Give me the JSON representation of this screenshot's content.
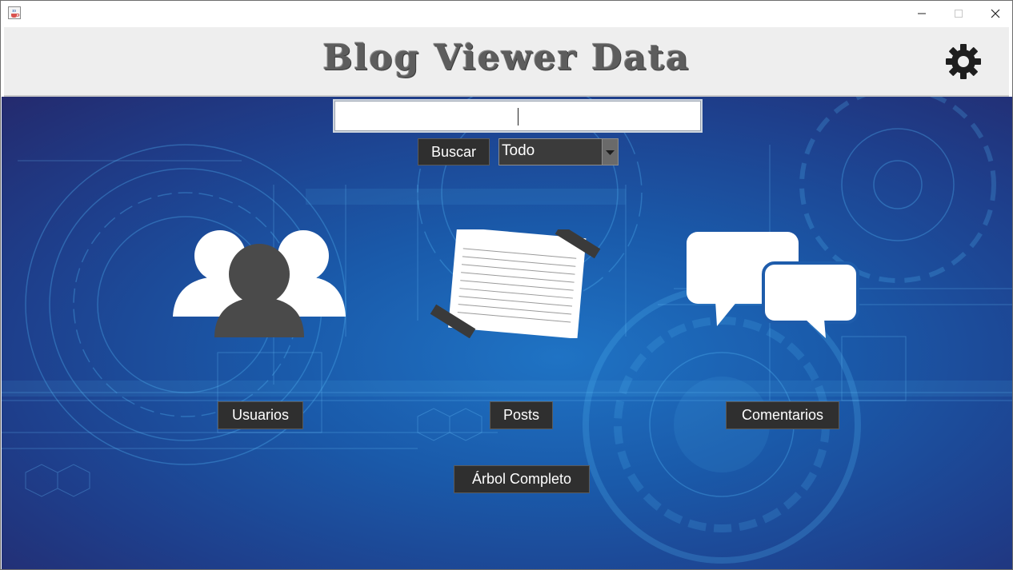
{
  "window": {
    "app_icon": "java-cup-icon",
    "controls": [
      "minimize-icon",
      "maximize-icon",
      "close-icon"
    ]
  },
  "header": {
    "title": "Blog Viewer Data",
    "settings_icon": "gear-icon"
  },
  "search": {
    "value": "",
    "button_label": "Buscar",
    "filter_selected": "Todo"
  },
  "sections": {
    "users": {
      "icon": "users-group-icon",
      "label": "Usuarios"
    },
    "posts": {
      "icon": "taped-note-icon",
      "label": "Posts"
    },
    "comments": {
      "icon": "speech-bubbles-icon",
      "label": "Comentarios"
    }
  },
  "tree_button_label": "Árbol Completo",
  "colors": {
    "header_bg": "#eeeeee",
    "title_color": "#5d5d5d",
    "button_bg": "#2f2f2f",
    "main_bg": "#1a5aaa",
    "icon_dark": "#4a4a4a",
    "icon_light": "#ffffff"
  }
}
